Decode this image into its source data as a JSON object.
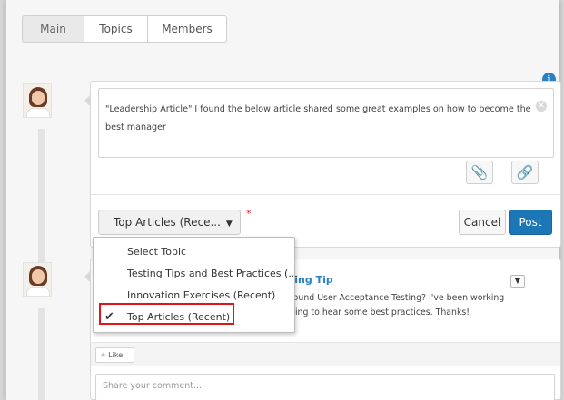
{
  "tabs": [
    {
      "label": "Main",
      "active": true
    },
    {
      "label": "Topics",
      "active": false
    },
    {
      "label": "Members",
      "active": false
    }
  ],
  "composer": {
    "text": "\"Leadership Article\" I found the below article shared some great examples on how to become the best manager",
    "topic_value": "Top Articles (Rece...",
    "required_marker": "*",
    "cancel_label": "Cancel",
    "post_label": "Post",
    "icons": [
      "info-icon",
      "attachment-icon",
      "link-icon",
      "clear-icon"
    ]
  },
  "topic_dropdown": {
    "options": [
      {
        "label": "Select Topic",
        "selected": false
      },
      {
        "label": "Testing Tips and Best Practices (...",
        "selected": false
      },
      {
        "label": "Innovation Exercises (Recent)",
        "selected": false
      },
      {
        "label": "Top Articles (Recent)",
        "selected": true
      }
    ]
  },
  "feed_post": {
    "title": "ting Tip",
    "body_line1": "round User Acceptance Testing? I've been working",
    "body_line2": "ping to hear some best practices. Thanks!",
    "like_label": "Like",
    "comment_placeholder": "Share your comment..."
  },
  "colors": {
    "accent": "#1b77b6",
    "highlight": "#e0141a",
    "link": "#2a7fc1"
  }
}
